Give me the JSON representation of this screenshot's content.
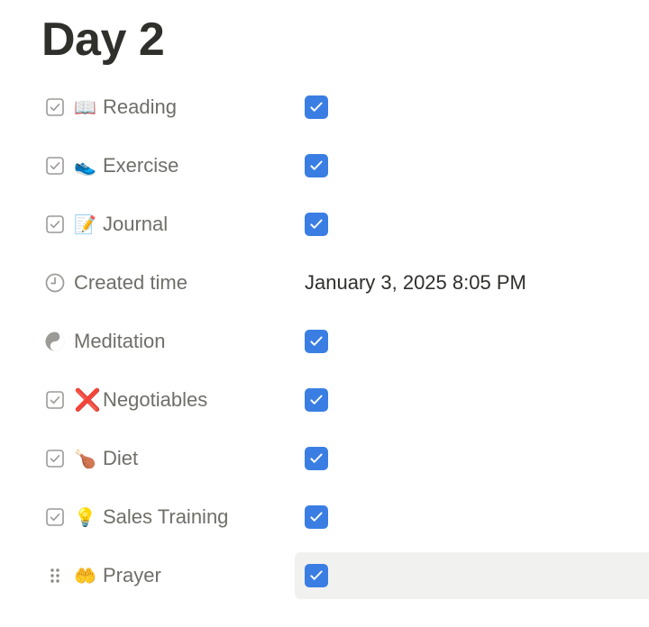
{
  "page": {
    "title": "Day 2"
  },
  "properties": [
    {
      "type": "checkbox",
      "type_icon": "checkbox-type-icon",
      "emoji": "📖",
      "emoji_name": "book-emoji-icon",
      "label": "Reading",
      "checked": true
    },
    {
      "type": "checkbox",
      "type_icon": "checkbox-type-icon",
      "emoji": "👟",
      "emoji_name": "shoe-emoji-icon",
      "label": "Exercise",
      "checked": true
    },
    {
      "type": "checkbox",
      "type_icon": "checkbox-type-icon",
      "emoji": "📝",
      "emoji_name": "memo-emoji-icon",
      "label": "Journal",
      "checked": true
    },
    {
      "type": "created_time",
      "type_icon": "clock-icon",
      "emoji": "",
      "emoji_name": "",
      "label": "Created time",
      "value": "January 3, 2025 8:05 PM"
    },
    {
      "type": "checkbox",
      "type_icon": "yin-yang-icon",
      "emoji": "",
      "emoji_name": "",
      "label": "Meditation",
      "checked": true
    },
    {
      "type": "checkbox",
      "type_icon": "checkbox-type-icon",
      "emoji": "❌",
      "emoji_name": "cross-mark-emoji-icon",
      "label": "Negotiables",
      "checked": true
    },
    {
      "type": "checkbox",
      "type_icon": "checkbox-type-icon",
      "emoji": "🍗",
      "emoji_name": "poultry-leg-emoji-icon",
      "label": "Diet",
      "checked": true
    },
    {
      "type": "checkbox",
      "type_icon": "checkbox-type-icon",
      "emoji": "💡",
      "emoji_name": "light-bulb-emoji-icon",
      "label": "Sales Training",
      "checked": true
    },
    {
      "type": "checkbox",
      "type_icon": "drag-handle-icon",
      "emoji": "🤲",
      "emoji_name": "palms-up-emoji-icon",
      "label": "Prayer",
      "checked": true,
      "hovered": true
    }
  ],
  "colors": {
    "checkbox_checked": "#3a7ee3",
    "label_text": "#6f6e69",
    "value_text": "#2f2f2c",
    "hover_bg": "#f1f1ef"
  }
}
